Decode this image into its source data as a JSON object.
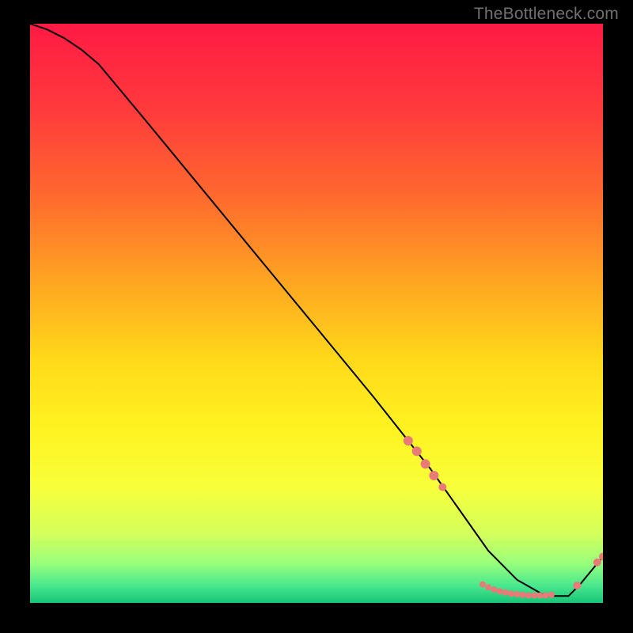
{
  "watermark": "TheBottleneck.com",
  "chart_data": {
    "type": "line",
    "title": "",
    "xlabel": "",
    "ylabel": "",
    "xlim": [
      0,
      100
    ],
    "ylim": [
      0,
      100
    ],
    "grid": false,
    "legend": false,
    "background": {
      "type": "vertical-gradient",
      "stops": [
        {
          "pos": 0.0,
          "color": "#ff1a44"
        },
        {
          "pos": 0.15,
          "color": "#ff3b3c"
        },
        {
          "pos": 0.3,
          "color": "#ff6a2e"
        },
        {
          "pos": 0.45,
          "color": "#ffa721"
        },
        {
          "pos": 0.58,
          "color": "#ffd91a"
        },
        {
          "pos": 0.7,
          "color": "#fff321"
        },
        {
          "pos": 0.8,
          "color": "#f7ff3a"
        },
        {
          "pos": 0.88,
          "color": "#d4ff5c"
        },
        {
          "pos": 0.93,
          "color": "#9bff7a"
        },
        {
          "pos": 0.97,
          "color": "#49e88e"
        },
        {
          "pos": 1.0,
          "color": "#18c477"
        }
      ]
    },
    "series": [
      {
        "name": "bottleneck-curve",
        "color": "#000000",
        "x": [
          0,
          3,
          6,
          9,
          12,
          20,
          30,
          40,
          50,
          60,
          66,
          70,
          75,
          80,
          85,
          90,
          94,
          96,
          100
        ],
        "y": [
          100,
          99,
          97.5,
          95.5,
          93,
          83.5,
          71.5,
          59.5,
          47.5,
          35.5,
          28,
          23,
          16,
          9,
          4,
          1.2,
          1.2,
          3.2,
          8
        ]
      }
    ],
    "markers": [
      {
        "x": 66,
        "y": 28,
        "r": 6
      },
      {
        "x": 67.5,
        "y": 26.2,
        "r": 6
      },
      {
        "x": 69,
        "y": 24,
        "r": 6
      },
      {
        "x": 70.5,
        "y": 22,
        "r": 6
      },
      {
        "x": 72,
        "y": 20,
        "r": 5
      },
      {
        "x": 79,
        "y": 3.2,
        "r": 4
      },
      {
        "x": 80,
        "y": 2.7,
        "r": 4
      },
      {
        "x": 81,
        "y": 2.3,
        "r": 4
      },
      {
        "x": 82,
        "y": 2.0,
        "r": 4
      },
      {
        "x": 83,
        "y": 1.8,
        "r": 4
      },
      {
        "x": 84,
        "y": 1.6,
        "r": 4
      },
      {
        "x": 85,
        "y": 1.5,
        "r": 4
      },
      {
        "x": 86,
        "y": 1.4,
        "r": 4
      },
      {
        "x": 87,
        "y": 1.3,
        "r": 4
      },
      {
        "x": 88,
        "y": 1.3,
        "r": 4
      },
      {
        "x": 89,
        "y": 1.3,
        "r": 4
      },
      {
        "x": 90,
        "y": 1.3,
        "r": 4
      },
      {
        "x": 91,
        "y": 1.4,
        "r": 4
      },
      {
        "x": 95.5,
        "y": 3.0,
        "r": 5
      },
      {
        "x": 99,
        "y": 7.0,
        "r": 5
      },
      {
        "x": 100,
        "y": 8.0,
        "r": 5
      }
    ],
    "marker_style": {
      "fill": "#e87a78",
      "stroke": "none"
    }
  }
}
